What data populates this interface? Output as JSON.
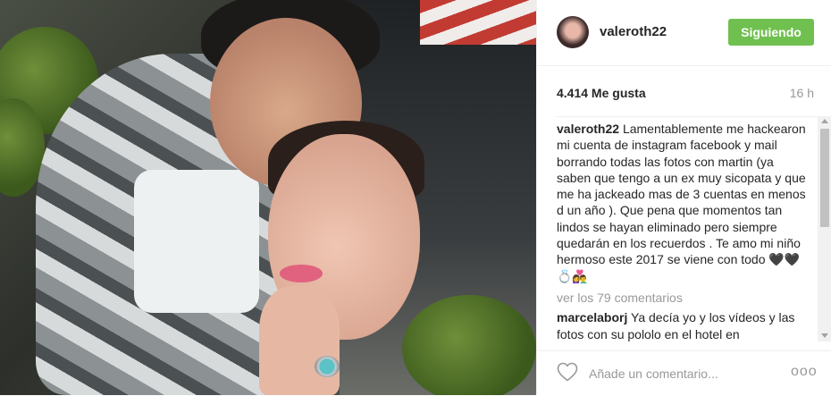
{
  "post": {
    "username": "valeroth22",
    "follow_label": "Siguiendo",
    "likes": "4.414 Me gusta",
    "time_ago": "16 h",
    "caption": "Lamentablemente me hackearon mi cuenta de instagram facebook y mail borrando todas las fotos con martin (ya saben que tengo a un ex muy sicopata y que me ha jackeado mas de 3 cuentas en menos d un año ). Que pena que momentos tan lindos se hayan eliminado pero siempre quedarán en los recuerdos . Te amo mi niño hermoso este 2017 se viene con todo 🖤🖤💍👩‍❤️‍👨",
    "view_all": "ver los 79 comentarios"
  },
  "comments": [
    {
      "user": "marcelaborj",
      "text": "Ya decía yo y los vídeos y las fotos con su pololo en el hotel en"
    }
  ],
  "add_comment": {
    "placeholder": "Añade un comentario...",
    "more": "ooo"
  },
  "colors": {
    "follow_button": "#70c050",
    "muted_text": "#999999"
  },
  "icons": [
    "heart-icon",
    "more-options-icon",
    "avatar"
  ]
}
